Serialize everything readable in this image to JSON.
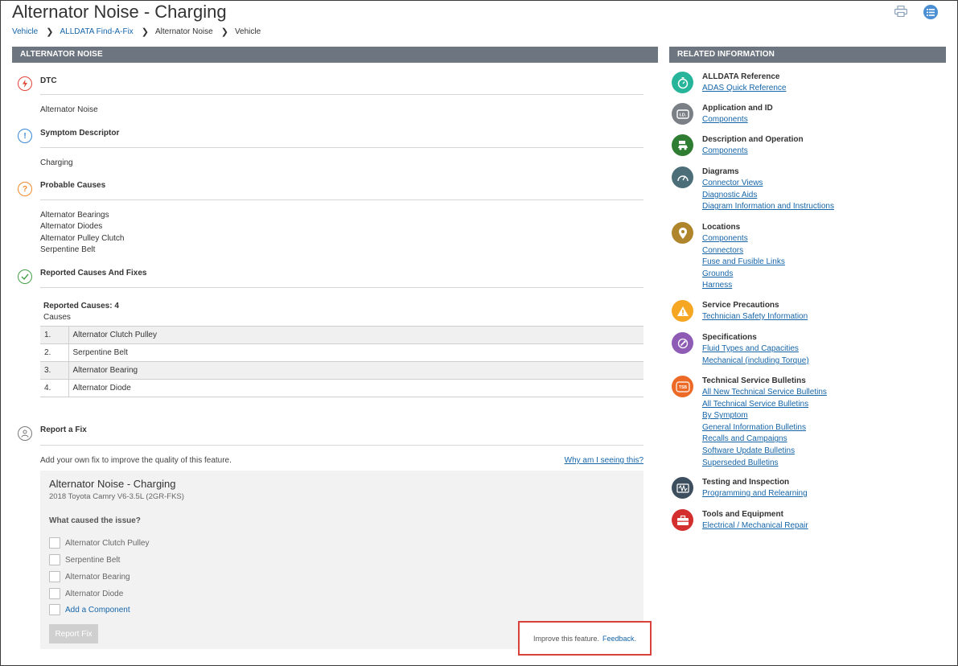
{
  "header": {
    "title": "Alternator Noise - Charging",
    "breadcrumbs": [
      "Vehicle",
      "ALLDATA Find-A-Fix",
      "Alternator Noise",
      "Vehicle"
    ]
  },
  "main": {
    "panel_title": "ALTERNATOR NOISE",
    "dtc": {
      "heading": "DTC",
      "value": "Alternator Noise"
    },
    "symptom": {
      "heading": "Symptom Descriptor",
      "value": "Charging"
    },
    "probable": {
      "heading": "Probable Causes",
      "items": [
        "Alternator Bearings",
        "Alternator Diodes",
        "Alternator Pulley Clutch",
        "Serpentine Belt"
      ]
    },
    "reported": {
      "heading": "Reported Causes And Fixes",
      "count_label": "Reported Causes: 4",
      "sub_label": "Causes",
      "rows": [
        {
          "num": "1.",
          "cause": "Alternator Clutch Pulley"
        },
        {
          "num": "2.",
          "cause": "Serpentine Belt"
        },
        {
          "num": "3.",
          "cause": "Alternator Bearing"
        },
        {
          "num": "4.",
          "cause": "Alternator Diode"
        }
      ]
    },
    "report_fix": {
      "heading": "Report a Fix",
      "description": "Add your own fix to improve the quality of this feature.",
      "why_link": "Why am I seeing this?",
      "box_title": "Alternator Noise - Charging",
      "vehicle": "2018 Toyota Camry V6-3.5L (2GR-FKS)",
      "question": "What caused the issue?",
      "options": [
        "Alternator Clutch Pulley",
        "Serpentine Belt",
        "Alternator Bearing",
        "Alternator Diode"
      ],
      "add_component": "Add a Component",
      "button": "Report Fix"
    },
    "feedback": {
      "text": "Improve this feature.",
      "link": "Feedback."
    }
  },
  "related": {
    "panel_title": "RELATED INFORMATION",
    "groups": [
      {
        "title": "ALLDATA Reference",
        "icon": "stopwatch-icon",
        "color": "#26b59a",
        "links": [
          "ADAS Quick Reference"
        ]
      },
      {
        "title": "Application and ID",
        "icon": "id-card-icon",
        "color": "#7b8087",
        "links": [
          "Components"
        ]
      },
      {
        "title": "Description and Operation",
        "icon": "car-info-icon",
        "color": "#2e7d32",
        "links": [
          "Components"
        ]
      },
      {
        "title": "Diagrams",
        "icon": "gauge-icon",
        "color": "#4b6e79",
        "links": [
          "Connector Views",
          "Diagnostic Aids",
          "Diagram Information and Instructions"
        ]
      },
      {
        "title": "Locations",
        "icon": "location-pin-icon",
        "color": "#b0862c",
        "links": [
          "Components",
          "Connectors",
          "Fuse and Fusible Links",
          "Grounds",
          "Harness"
        ]
      },
      {
        "title": "Service Precautions",
        "icon": "warning-icon",
        "color": "#f5a623",
        "links": [
          "Technician Safety Information"
        ]
      },
      {
        "title": "Specifications",
        "icon": "wrench-icon",
        "color": "#8e5bb5",
        "links": [
          "Fluid Types and Capacities",
          "Mechanical (including Torque)"
        ]
      },
      {
        "title": "Technical Service Bulletins",
        "icon": "tsb-icon",
        "color": "#ec6a26",
        "links": [
          "All New Technical Service Bulletins",
          "All Technical Service Bulletins",
          "By Symptom",
          "General Information Bulletins",
          "Recalls and Campaigns",
          "Software Update Bulletins",
          "Superseded Bulletins"
        ]
      },
      {
        "title": "Testing and Inspection",
        "icon": "oscilloscope-icon",
        "color": "#3d4f5e",
        "links": [
          "Programming and Relearning"
        ]
      },
      {
        "title": "Tools and Equipment",
        "icon": "toolbox-icon",
        "color": "#d32f2f",
        "links": [
          "Electrical / Mechanical Repair"
        ]
      }
    ]
  }
}
